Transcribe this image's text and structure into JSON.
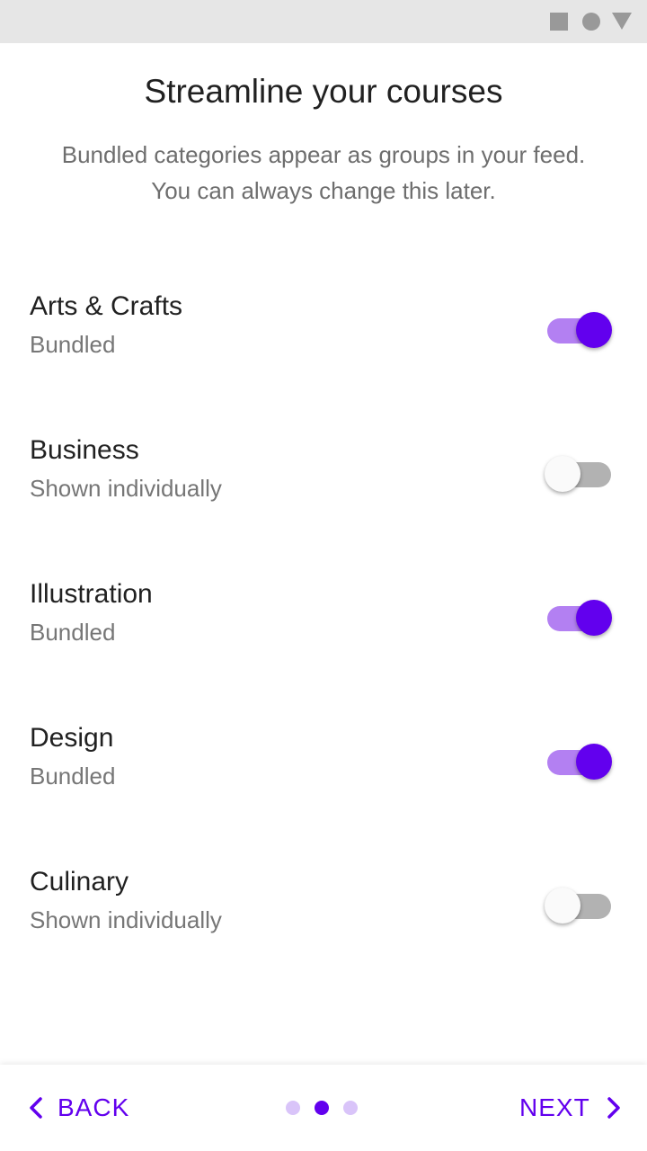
{
  "header": {
    "title": "Streamline your courses",
    "subtitle_line1": "Bundled categories appear as groups in your feed.",
    "subtitle_line2": "You can always change this later."
  },
  "categories": [
    {
      "name": "Arts & Crafts",
      "status": "Bundled",
      "enabled": true
    },
    {
      "name": "Business",
      "status": "Shown individually",
      "enabled": false
    },
    {
      "name": "Illustration",
      "status": "Bundled",
      "enabled": true
    },
    {
      "name": "Design",
      "status": "Bundled",
      "enabled": true
    },
    {
      "name": "Culinary",
      "status": "Shown individually",
      "enabled": false
    }
  ],
  "footer": {
    "back_label": "BACK",
    "next_label": "NEXT",
    "page_count": 3,
    "current_page": 2
  },
  "colors": {
    "accent": "#6200ee",
    "switch_track_on": "#b380f2",
    "switch_track_off": "#b2b2b2",
    "dot_inactive": "#d9c4f9"
  },
  "status_bar_icons": [
    "stop-icon",
    "circle-icon",
    "triangle-down-icon"
  ]
}
